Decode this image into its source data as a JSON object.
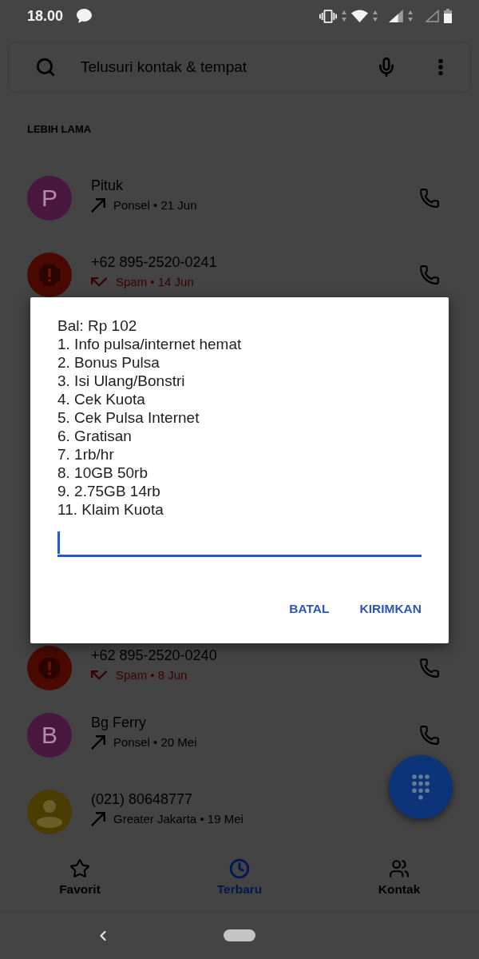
{
  "status_bar": {
    "time": "18.00"
  },
  "search": {
    "placeholder": "Telusuri kontak & tempat"
  },
  "section_header": "LEBIH LAMA",
  "calls_above": [
    {
      "name": "Pituk",
      "avatar": {
        "kind": "letter",
        "letter": "P",
        "color": "#4a1741"
      },
      "kind": "outgoing",
      "detail": "Ponsel • 21 Jun",
      "spam": false,
      "call_button": true
    },
    {
      "name": "+62 895-2520-0241",
      "avatar": {
        "kind": "spam",
        "color": "#4a0a02"
      },
      "kind": "missed",
      "detail": "Spam • 14 Jun",
      "spam": true,
      "call_button": true
    }
  ],
  "dialog": {
    "lines": [
      "Bal: Rp 102",
      "1. Info pulsa/internet hemat",
      "2. Bonus Pulsa",
      "3. Isi Ulang/Bonstri",
      "4. Cek Kuota",
      "5. Cek Pulsa Internet",
      "6. Gratisan",
      "7. 1rb/hr",
      "8. 10GB 50rb",
      "9. 2.75GB 14rb",
      "11. Klaim Kuota"
    ],
    "input": {
      "focused": true
    },
    "buttons": [
      {
        "label": "BATAL"
      },
      {
        "label": "KIRIMKAN"
      }
    ]
  },
  "calls_below": [
    {
      "name": "+62 895-2520-0240",
      "avatar": {
        "kind": "spam",
        "color": "#4a0a02"
      },
      "kind": "missed",
      "detail": "Spam • 8 Jun",
      "spam": true,
      "call_button": true
    },
    {
      "name": "Bg Ferry",
      "avatar": {
        "kind": "letter",
        "letter": "B",
        "color": "#4a1741"
      },
      "kind": "outgoing",
      "detail": "Ponsel • 20 Mei",
      "spam": false,
      "call_button": true
    },
    {
      "name": "(021) 80648777",
      "avatar": {
        "kind": "unknown",
        "color": "#4a3d02"
      },
      "kind": "outgoing",
      "detail": "Greater Jakarta • 19 Mei",
      "spam": false,
      "call_button": false
    }
  ],
  "bottom_nav": [
    {
      "label": "Favorit",
      "selected": false
    },
    {
      "label": "Terbaru",
      "selected": true
    },
    {
      "label": "Kontak",
      "selected": false
    }
  ]
}
